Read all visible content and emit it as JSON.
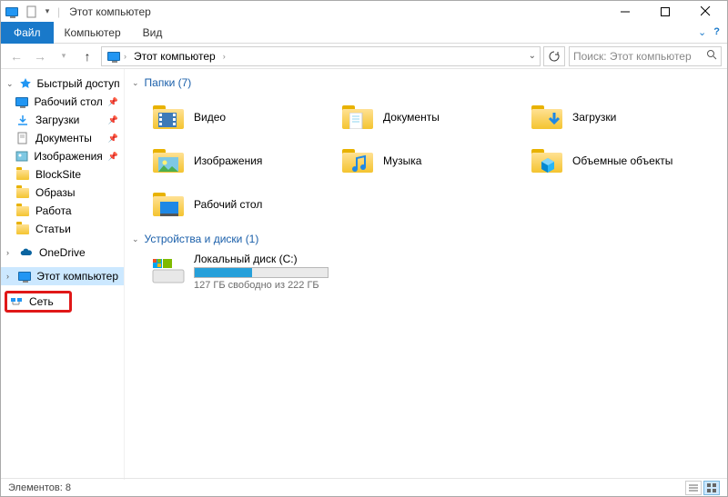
{
  "titlebar": {
    "title": "Этот компьютер"
  },
  "menu": {
    "file": "Файл",
    "computer": "Компьютер",
    "view": "Вид"
  },
  "addr": {
    "crumb": "Этот компьютер"
  },
  "search": {
    "placeholder": "Поиск: Этот компьютер"
  },
  "sidebar": {
    "quick_access": "Быстрый доступ",
    "items": [
      {
        "label": "Рабочий стол"
      },
      {
        "label": "Загрузки"
      },
      {
        "label": "Документы"
      },
      {
        "label": "Изображения"
      },
      {
        "label": "BlockSite"
      },
      {
        "label": "Образы"
      },
      {
        "label": "Работа"
      },
      {
        "label": "Статьи"
      }
    ],
    "onedrive": "OneDrive",
    "this_pc": "Этот компьютер",
    "network": "Сеть"
  },
  "groups": {
    "folders_label": "Папки (7)",
    "folders": [
      "Видео",
      "Документы",
      "Загрузки",
      "Изображения",
      "Музыка",
      "Объемные объекты",
      "Рабочий стол"
    ],
    "drives_label": "Устройства и диски (1)",
    "drive": {
      "name": "Локальный диск (C:)",
      "sub": "127 ГБ свободно из 222 ГБ",
      "fill_percent": 43
    }
  },
  "status": {
    "text": "Элементов: 8"
  }
}
